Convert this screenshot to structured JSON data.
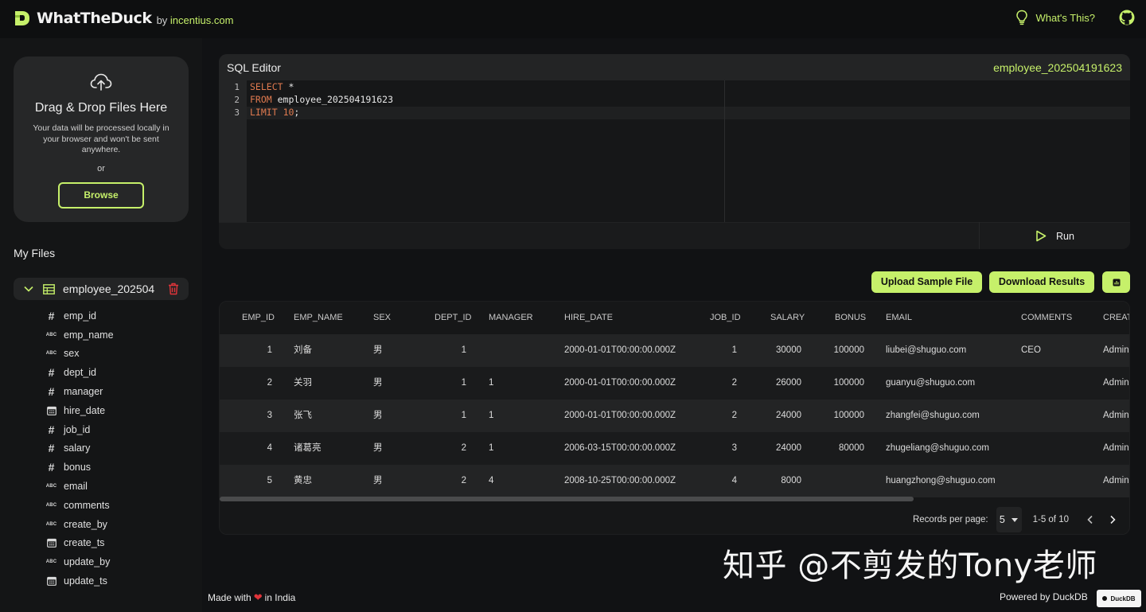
{
  "brand": {
    "name": "WhatTheDuck",
    "by_text": "by",
    "by_link": "incentius.com"
  },
  "header": {
    "whats_this": "What's This?"
  },
  "upload": {
    "title": "Drag & Drop Files Here",
    "description": "Your data will be processed locally in your browser and won't be sent anywhere.",
    "or": "or",
    "browse_label": "Browse"
  },
  "files": {
    "heading": "My Files",
    "items": [
      {
        "name": "employee_202504",
        "columns": [
          {
            "name": "emp_id",
            "type": "number"
          },
          {
            "name": "emp_name",
            "type": "text"
          },
          {
            "name": "sex",
            "type": "text"
          },
          {
            "name": "dept_id",
            "type": "number"
          },
          {
            "name": "manager",
            "type": "number"
          },
          {
            "name": "hire_date",
            "type": "date"
          },
          {
            "name": "job_id",
            "type": "number"
          },
          {
            "name": "salary",
            "type": "number"
          },
          {
            "name": "bonus",
            "type": "number"
          },
          {
            "name": "email",
            "type": "text"
          },
          {
            "name": "comments",
            "type": "text"
          },
          {
            "name": "create_by",
            "type": "text"
          },
          {
            "name": "create_ts",
            "type": "date"
          },
          {
            "name": "update_by",
            "type": "text"
          },
          {
            "name": "update_ts",
            "type": "date"
          }
        ]
      }
    ]
  },
  "type_icons": {
    "number": "#",
    "text": "ABC"
  },
  "editor": {
    "title": "SQL Editor",
    "table_name": "employee_202504191623",
    "line_numbers": [
      "1",
      "2",
      "3"
    ],
    "lines": [
      {
        "kw": "SELECT",
        "rest": " *",
        "num": "",
        "tail": ""
      },
      {
        "kw": "FROM",
        "rest": " employee_202504191623",
        "num": "",
        "tail": ""
      },
      {
        "kw": "LIMIT",
        "rest": " ",
        "num": "10",
        "tail": ";"
      }
    ],
    "run_label": "Run"
  },
  "actions": {
    "upload_sample": "Upload Sample File",
    "download_results": "Download Results"
  },
  "results": {
    "columns": [
      "EMP_ID",
      "EMP_NAME",
      "SEX",
      "DEPT_ID",
      "MANAGER",
      "HIRE_DATE",
      "JOB_ID",
      "SALARY",
      "BONUS",
      "EMAIL",
      "COMMENTS",
      "CREATE"
    ],
    "rows": [
      [
        "1",
        "刘备",
        "男",
        "1",
        "",
        "2000-01-01T00:00:00.000Z",
        "1",
        "30000",
        "100000",
        "liubei@shuguo.com",
        "CEO",
        "Admin"
      ],
      [
        "2",
        "关羽",
        "男",
        "1",
        "1",
        "2000-01-01T00:00:00.000Z",
        "2",
        "26000",
        "100000",
        "guanyu@shuguo.com",
        "",
        "Admin"
      ],
      [
        "3",
        "张飞",
        "男",
        "1",
        "1",
        "2000-01-01T00:00:00.000Z",
        "2",
        "24000",
        "100000",
        "zhangfei@shuguo.com",
        "",
        "Admin"
      ],
      [
        "4",
        "诸葛亮",
        "男",
        "2",
        "1",
        "2006-03-15T00:00:00.000Z",
        "3",
        "24000",
        "80000",
        "zhugeliang@shuguo.com",
        "",
        "Admin"
      ],
      [
        "5",
        "黄忠",
        "男",
        "2",
        "4",
        "2008-10-25T00:00:00.000Z",
        "4",
        "8000",
        "",
        "huangzhong@shuguo.com",
        "",
        "Admin"
      ]
    ],
    "records_per_page_label": "Records per page:",
    "records_per_page": "5",
    "range": "1-5 of 10"
  },
  "footer": {
    "made_prefix": "Made with",
    "made_suffix": "in India",
    "powered": "Powered by DuckDB",
    "badge": "DuckDB"
  },
  "watermark": "知乎 @不剪发的Tony老师",
  "colors": {
    "accent": "#c6f06a",
    "background": "#111214",
    "panel": "#1a1b1c",
    "keyword": "#e07a4f",
    "danger": "#e0343a"
  }
}
